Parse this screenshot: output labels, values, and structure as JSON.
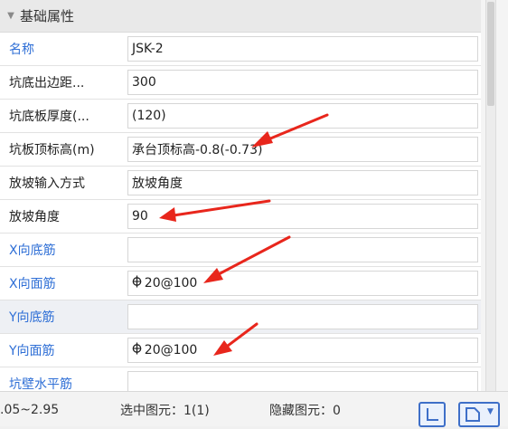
{
  "panel": {
    "group_title": "基础属性",
    "rows": [
      {
        "name": "名称",
        "value": "JSK-2"
      },
      {
        "name": "坑底出边距...",
        "value": "300"
      },
      {
        "name": "坑底板厚度(...",
        "value": "(120)"
      },
      {
        "name": "坑板顶标高(m)",
        "value": "承台顶标高-0.8(-0.73)"
      },
      {
        "name": "放坡输入方式",
        "value": "放坡角度"
      },
      {
        "name": "放坡角度",
        "value": "90"
      },
      {
        "name": "X向底筋",
        "value": ""
      },
      {
        "name": "X向面筋",
        "value": " 20@100"
      },
      {
        "name": "Y向底筋",
        "value": ""
      },
      {
        "name": "Y向面筋",
        "value": " 20@100"
      },
      {
        "name": "坑壁水平筋",
        "value": ""
      }
    ]
  },
  "status": {
    "range": ".05~2.95",
    "selected": "选中图元：1(1)",
    "hidden": "隐藏图元：0"
  },
  "colors": {
    "accent_blue": "#2f6fd6",
    "annotation_red": "#e8261c"
  },
  "icons": [
    "collapse-triangle-icon",
    "rebar-symbol-icon",
    "angle-snap-icon",
    "select-mode-icon",
    "dropdown-icon"
  ]
}
